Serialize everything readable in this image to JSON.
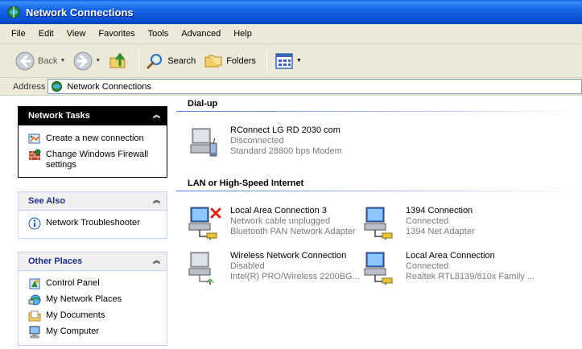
{
  "window": {
    "title": "Network Connections"
  },
  "menu": [
    "File",
    "Edit",
    "View",
    "Favorites",
    "Tools",
    "Advanced",
    "Help"
  ],
  "toolbar": {
    "back_label": "Back",
    "search_label": "Search",
    "folders_label": "Folders"
  },
  "address": {
    "label": "Address",
    "value": "Network Connections"
  },
  "network_tasks": {
    "title": "Network Tasks",
    "items": [
      {
        "label": "Create a new connection",
        "icon": "new-connection-icon"
      },
      {
        "label": "Change Windows Firewall settings",
        "icon": "firewall-icon"
      }
    ]
  },
  "see_also": {
    "title": "See Also",
    "items": [
      {
        "label": "Network Troubleshooter",
        "icon": "info-icon"
      }
    ]
  },
  "other_places": {
    "title": "Other Places",
    "items": [
      {
        "label": "Control Panel",
        "icon": "control-panel-icon"
      },
      {
        "label": "My Network Places",
        "icon": "network-places-icon"
      },
      {
        "label": "My Documents",
        "icon": "my-documents-icon"
      },
      {
        "label": "My Computer",
        "icon": "my-computer-icon"
      }
    ]
  },
  "groups": {
    "dialup": {
      "title": "Dial-up",
      "items": [
        {
          "name": "RConnect LG RD 2030 com",
          "status": "Disconnected",
          "device": "Standard 28800 bps Modem",
          "kind": "modem"
        }
      ]
    },
    "lan": {
      "title": "LAN or High-Speed Internet",
      "items": [
        {
          "name": "Local Area Connection 3",
          "status": "Network cable unplugged",
          "device": "Bluetooth PAN Network Adapter",
          "kind": "lan-unplugged"
        },
        {
          "name": "1394 Connection",
          "status": "Connected",
          "device": "1394 Net Adapter",
          "kind": "lan"
        },
        {
          "name": "Wireless Network Connection",
          "status": "Disabled",
          "device": "Intel(R) PRO/Wireless 2200BG...",
          "kind": "wireless-disabled"
        },
        {
          "name": "Local Area Connection",
          "status": "Connected",
          "device": "Realtek RTL8139/810x Family ...",
          "kind": "lan"
        }
      ]
    }
  },
  "colors": {
    "titlebar": "#0a5ee8",
    "chrome": "#ece9d8",
    "panel_header_dark": "#000000",
    "panel_header_light": "#f0f0f0",
    "secondary_text": "#7b7b7b"
  }
}
